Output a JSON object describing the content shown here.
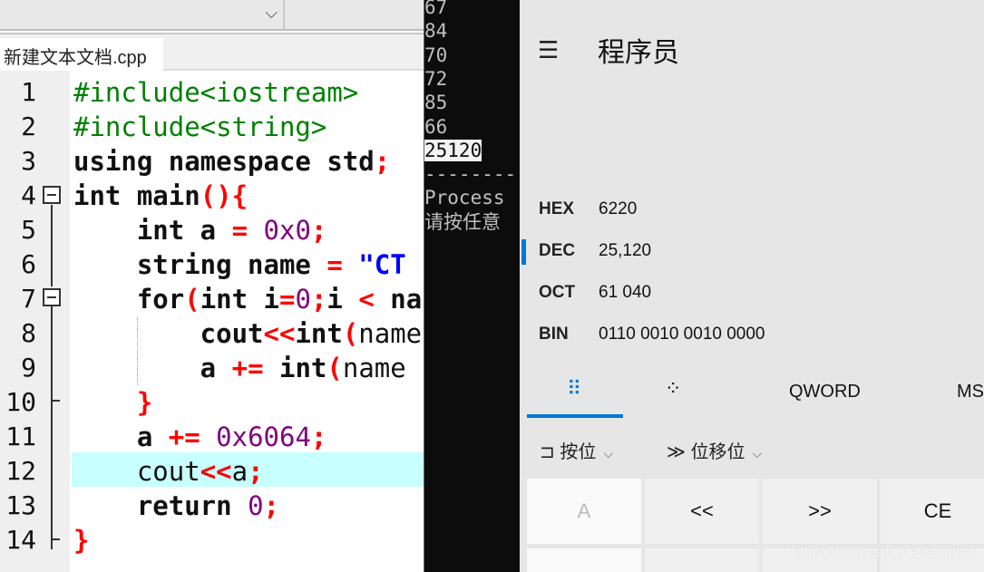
{
  "editor": {
    "tab_title": "新建文本文档.cpp",
    "line_numbers": [
      "1",
      "2",
      "3",
      "4",
      "5",
      "6",
      "7",
      "8",
      "9",
      "10",
      "11",
      "12",
      "13",
      "14"
    ],
    "lines": [
      [
        [
          "g",
          "#include<iostream>"
        ]
      ],
      [
        [
          "g",
          "#include<string>"
        ]
      ],
      [
        [
          "k",
          "using namespace std"
        ],
        [
          "p",
          ";"
        ]
      ],
      [
        [
          "k",
          "int main"
        ],
        [
          "p",
          "(){"
        ]
      ],
      [
        [
          "k",
          "    int a "
        ],
        [
          "p",
          "= "
        ],
        [
          "n",
          "0x0"
        ],
        [
          "p",
          ";"
        ]
      ],
      [
        [
          "k",
          "    string name "
        ],
        [
          "p",
          "= "
        ],
        [
          "s",
          "\"CT"
        ]
      ],
      [
        [
          "k",
          "    for"
        ],
        [
          "p",
          "("
        ],
        [
          "k",
          "int i"
        ],
        [
          "p",
          "="
        ],
        [
          "n",
          "0"
        ],
        [
          "p",
          ";"
        ],
        [
          "k",
          "i "
        ],
        [
          "p",
          "< "
        ],
        [
          "k",
          "na"
        ]
      ],
      [
        [
          "k",
          "        cout"
        ],
        [
          "p",
          "<<"
        ],
        [
          "k",
          "int"
        ],
        [
          "p",
          "("
        ],
        [
          "t",
          "name"
        ]
      ],
      [
        [
          "k",
          "        a "
        ],
        [
          "p",
          "+= "
        ],
        [
          "k",
          "int"
        ],
        [
          "p",
          "("
        ],
        [
          "t",
          "name"
        ]
      ],
      [
        [
          "p",
          "    }"
        ]
      ],
      [
        [
          "k",
          "    a "
        ],
        [
          "p",
          "+= "
        ],
        [
          "n",
          "0x6064"
        ],
        [
          "p",
          ";"
        ]
      ],
      [
        [
          "t",
          "    cout"
        ],
        [
          "p",
          "<<"
        ],
        [
          "t",
          "a"
        ],
        [
          "p",
          ";"
        ]
      ],
      [
        [
          "k",
          "    return "
        ],
        [
          "n",
          "0"
        ],
        [
          "p",
          ";"
        ]
      ],
      [
        [
          "p",
          "}"
        ]
      ]
    ],
    "highlighted_line": 12
  },
  "console": {
    "lines": [
      "67",
      "84",
      "70",
      "72",
      "85",
      "66",
      "25120",
      "--------",
      "Process",
      "请按任意"
    ],
    "selected": "25120"
  },
  "calculator": {
    "mode_title": "程序员",
    "menu_icon": "hamburger-icon",
    "accent": "#0078d7",
    "radix": [
      {
        "label": "HEX",
        "value": "6220"
      },
      {
        "label": "DEC",
        "value": "25,120",
        "active": true
      },
      {
        "label": "OCT",
        "value": "61 040"
      },
      {
        "label": "BIN",
        "value": "0110 0010 0010 0000"
      }
    ],
    "tabs": {
      "keypad_icon": "full-keypad-icon",
      "bit_icon": "bit-toggle-icon",
      "word_size": "QWORD",
      "memory": "MS"
    },
    "bitwise_label": "按位",
    "bitshift_label": "位移位",
    "keys": [
      "A",
      "<<",
      ">>",
      "CE"
    ]
  },
  "watermark": "https://blog.csdn.net/shipsail"
}
